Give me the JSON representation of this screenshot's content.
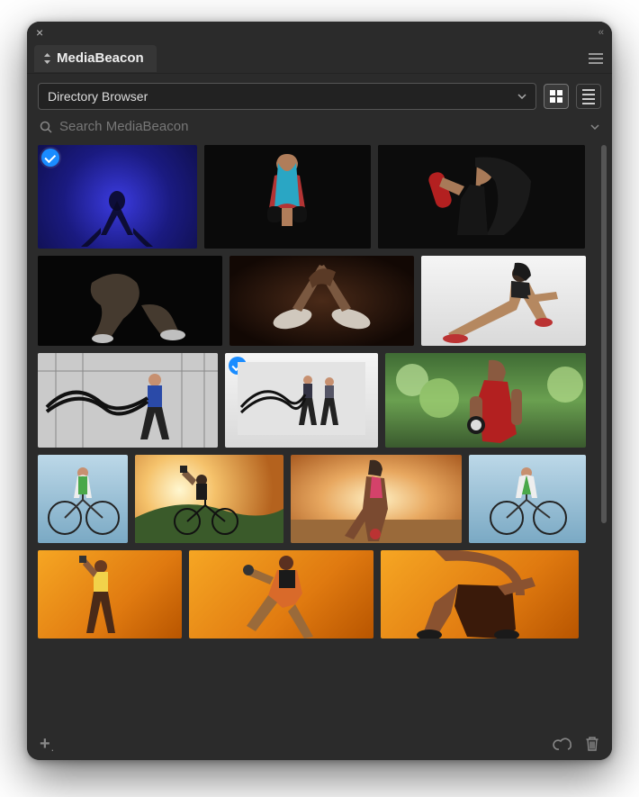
{
  "panel": {
    "tab_label": "MediaBeacon"
  },
  "toolbar": {
    "select_label": "Directory Browser",
    "view_mode": "grid"
  },
  "search": {
    "placeholder": "Search MediaBeacon"
  },
  "assets": [
    {
      "selected": true
    },
    {
      "selected": false
    },
    {
      "selected": false
    },
    {
      "selected": false
    },
    {
      "selected": false
    },
    {
      "selected": false
    },
    {
      "selected": false
    },
    {
      "selected": true
    },
    {
      "selected": false
    },
    {
      "selected": false
    },
    {
      "selected": false
    },
    {
      "selected": false
    },
    {
      "selected": false
    },
    {
      "selected": false
    },
    {
      "selected": false
    },
    {
      "selected": false
    }
  ]
}
